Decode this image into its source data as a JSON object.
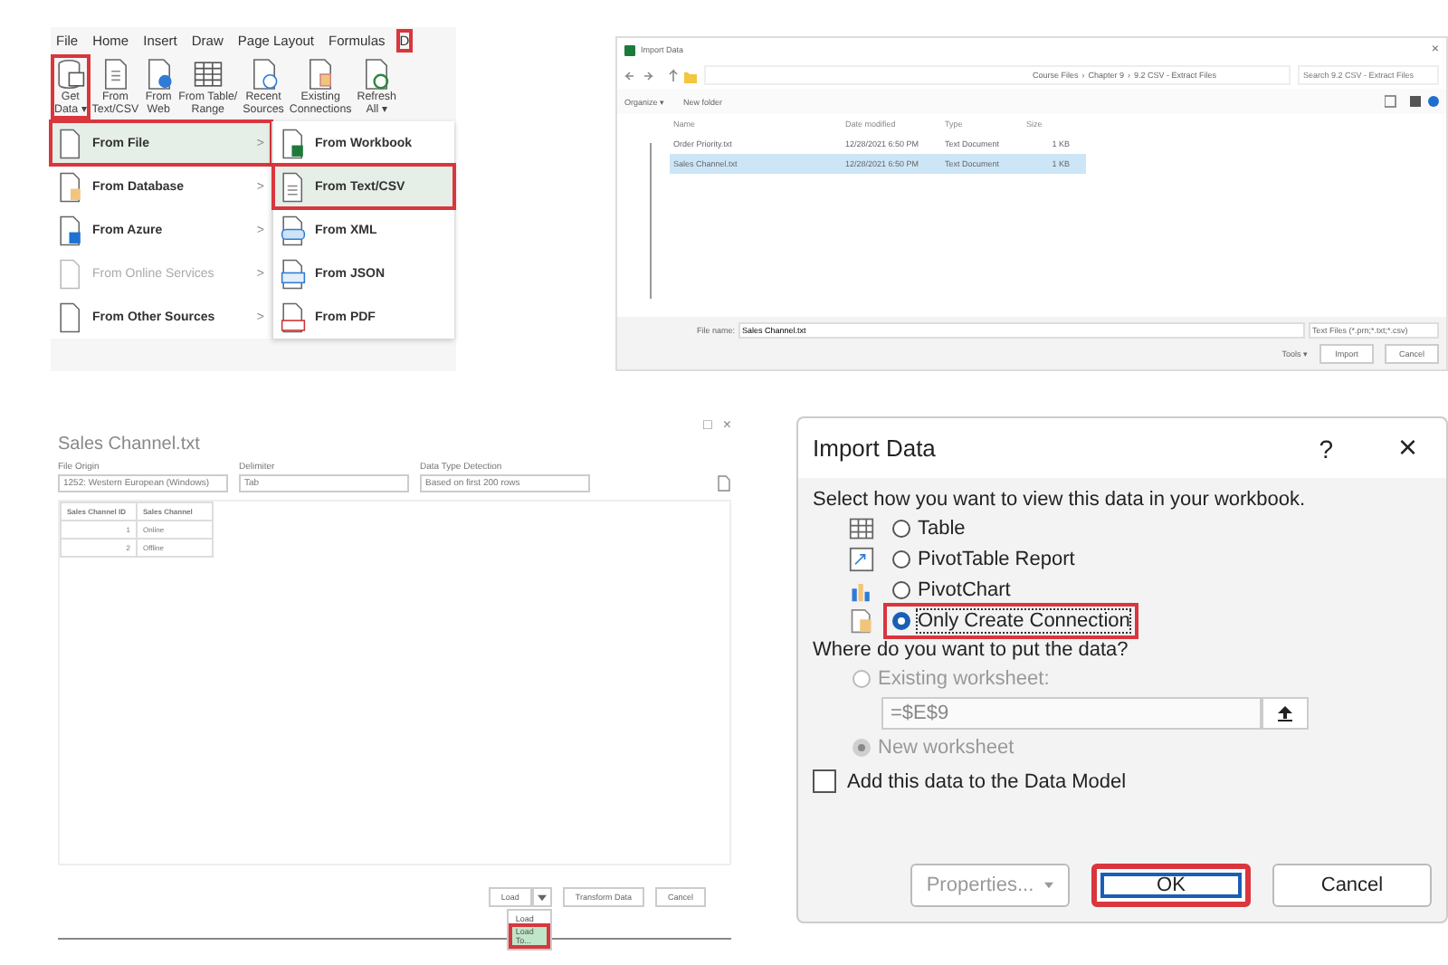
{
  "excel_ribbon": {
    "tabs": [
      {
        "label": "File",
        "highlighted": false
      },
      {
        "label": "Home",
        "highlighted": false
      },
      {
        "label": "Insert",
        "highlighted": false
      },
      {
        "label": "Draw",
        "highlighted": false
      },
      {
        "label": "Page Layout",
        "highlighted": false
      },
      {
        "label": "Formulas",
        "highlighted": false
      },
      {
        "label": "D",
        "highlighted": true
      }
    ],
    "buttons": [
      {
        "kind": "database",
        "lines": [
          "Get",
          "Data ▾"
        ],
        "highlighted": true
      },
      {
        "kind": "text",
        "lines": [
          "From",
          "Text/CSV"
        ],
        "highlighted": false
      },
      {
        "kind": "web",
        "lines": [
          "From",
          "Web"
        ],
        "highlighted": false
      },
      {
        "kind": "table",
        "lines": [
          "From Table/",
          "Range"
        ],
        "highlighted": false
      },
      {
        "kind": "clock",
        "lines": [
          "Recent",
          "Sources"
        ],
        "highlighted": false
      },
      {
        "kind": "doc",
        "lines": [
          "Existing",
          "Connections"
        ],
        "highlighted": false
      },
      {
        "kind": "refresh",
        "lines": [
          "Refresh",
          "All ▾"
        ],
        "highlighted": false
      }
    ],
    "menu": [
      {
        "label": "From File",
        "arrow": ">",
        "selected": true,
        "highlighted": true,
        "disabled": false
      },
      {
        "label": "From Database",
        "arrow": ">",
        "selected": false,
        "highlighted": false,
        "disabled": false
      },
      {
        "label": "From Azure",
        "arrow": ">",
        "selected": false,
        "highlighted": false,
        "disabled": false
      },
      {
        "label": "From Online Services",
        "arrow": ">",
        "selected": false,
        "highlighted": false,
        "disabled": true
      },
      {
        "label": "From Other Sources",
        "arrow": ">",
        "selected": false,
        "highlighted": false,
        "disabled": false
      }
    ],
    "submenu": [
      {
        "kind": "workbook",
        "label": "From Workbook",
        "selected": false,
        "highlighted": false
      },
      {
        "kind": "text",
        "label": "From Text/CSV",
        "selected": true,
        "highlighted": true
      },
      {
        "kind": "xml",
        "label": "From XML",
        "selected": false,
        "highlighted": false
      },
      {
        "kind": "json",
        "label": "From JSON",
        "selected": false,
        "highlighted": false
      },
      {
        "kind": "pdf",
        "label": "From PDF",
        "selected": false,
        "highlighted": false
      }
    ]
  },
  "file_dialog": {
    "title": "Import Data",
    "close": "×",
    "path": [
      "Course Files",
      "›",
      "Chapter 9",
      "›",
      "9.2 CSV - Extract Files"
    ],
    "search": {
      "placeholder": "Search 9.2 CSV - Extract Files"
    },
    "toolbar": [
      "Organize ▾",
      "New folder"
    ],
    "columns": [
      "Name",
      "Date modified",
      "Type",
      "Size"
    ],
    "files": [
      {
        "name": "Order Priority.txt",
        "date": "12/28/2021 6:50 PM",
        "type": "Text Document",
        "size": "1 KB",
        "selected": false
      },
      {
        "name": "Sales Channel.txt",
        "date": "12/28/2021 6:50 PM",
        "type": "Text Document",
        "size": "1 KB",
        "selected": true
      }
    ],
    "file_name_label": "File name:",
    "file_name": "Sales Channel.txt",
    "filter": "Text Files (*.prn;*.txt;*.csv)",
    "tools": "Tools ▾",
    "buttons": [
      "Import",
      "Cancel"
    ]
  },
  "preview_window": {
    "title": "Sales Channel.txt",
    "controls": [
      "□",
      "×"
    ],
    "fields": [
      {
        "label": "File Origin",
        "value": "1252: Western European (Windows)"
      },
      {
        "label": "Delimiter",
        "value": "Tab"
      },
      {
        "label": "Data Type Detection",
        "value": "Based on first 200 rows"
      }
    ],
    "table": {
      "columns": [
        "Sales Channel ID",
        "Sales Channel"
      ],
      "rows": [
        [
          "1",
          "Online"
        ],
        [
          "2",
          "Offline"
        ]
      ]
    },
    "buttons": [
      {
        "label": "Load",
        "kind": "split"
      },
      {
        "label": "Transform Data",
        "kind": "plain"
      },
      {
        "label": "Cancel",
        "kind": "plain"
      }
    ],
    "load_menu": [
      {
        "label": "Load",
        "selected": false,
        "highlighted": false
      },
      {
        "label": "Load To...",
        "selected": true,
        "highlighted": true
      }
    ]
  },
  "import_dialog": {
    "title": "Import Data",
    "help": "?",
    "close": "×",
    "prompt": "Select how you want to view this data in your workbook.",
    "view_options": [
      {
        "kind": "table",
        "label": "Table",
        "selected": false,
        "highlighted": false
      },
      {
        "kind": "pivottable",
        "label": "PivotTable Report",
        "selected": false,
        "highlighted": false
      },
      {
        "kind": "pivotchart",
        "label": "PivotChart",
        "selected": false,
        "highlighted": false
      },
      {
        "kind": "connection",
        "label": "Only Create Connection",
        "selected": true,
        "highlighted": true
      }
    ],
    "location_prompt": "Where do you want to put the data?",
    "location_options": [
      {
        "label": "Existing worksheet:",
        "selected": false,
        "disabled": true
      },
      {
        "label": "New worksheet",
        "selected": true,
        "disabled": true
      }
    ],
    "reference": "=$E$9",
    "data_model": {
      "label": "Add this data to the Data Model",
      "checked": false
    },
    "buttons": [
      {
        "label": "Properties...",
        "kind": "split",
        "highlighted": false,
        "disabled": true
      },
      {
        "label": "OK",
        "kind": "default",
        "highlighted": true,
        "disabled": false
      },
      {
        "label": "Cancel",
        "kind": "plain",
        "highlighted": false,
        "disabled": false
      }
    ]
  }
}
